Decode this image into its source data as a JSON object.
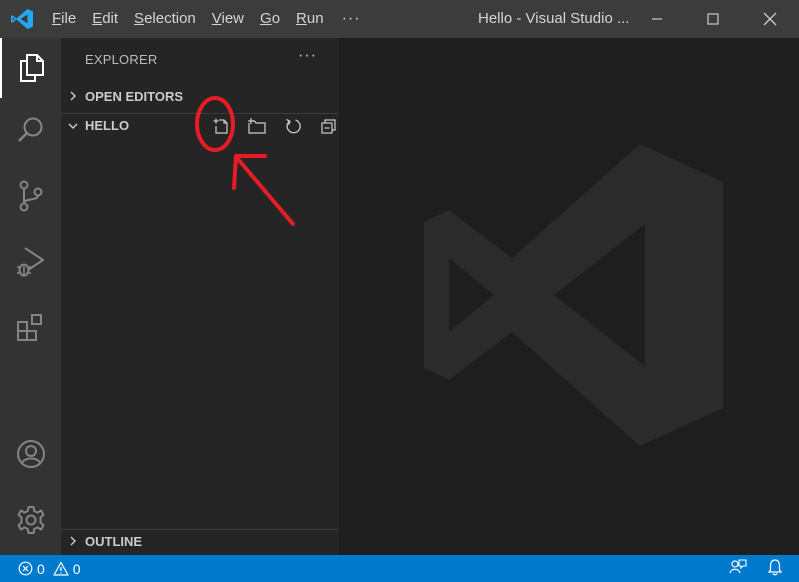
{
  "titlebar": {
    "menu": {
      "file": {
        "mn": "F",
        "rest": "ile"
      },
      "edit": {
        "mn": "E",
        "rest": "dit"
      },
      "selection": {
        "mn": "S",
        "rest": "election"
      },
      "view": {
        "mn": "V",
        "rest": "iew"
      },
      "go": {
        "mn": "G",
        "rest": "o"
      },
      "run": {
        "mn": "R",
        "rest": "un"
      }
    },
    "more": "···",
    "window_title": "Hello - Visual Studio ..."
  },
  "activity_bar": {
    "items": [
      "explorer-icon",
      "search-icon",
      "source-control-icon",
      "run-debug-icon",
      "extensions-icon"
    ],
    "bottom": [
      "accounts-icon",
      "manage-gear-icon"
    ]
  },
  "sidebar": {
    "title": "EXPLORER",
    "more": "···",
    "open_editors": "OPEN EDITORS",
    "folder": "HELLO",
    "folder_actions": [
      "new-file-icon",
      "new-folder-icon",
      "refresh-icon",
      "collapse-all-icon"
    ],
    "outline": "OUTLINE"
  },
  "statusbar": {
    "errors": "0",
    "warnings": "0",
    "right_icons": [
      "feedback-icon",
      "notifications-bell-icon"
    ]
  },
  "colors": {
    "titlebar": "#3c3c3c",
    "activitybar": "#333333",
    "sidebar": "#252526",
    "editor": "#1e1e1e",
    "statusbar": "#007acc",
    "vscode_blue": "#23a9f2",
    "annotation_red": "#e81c24"
  }
}
